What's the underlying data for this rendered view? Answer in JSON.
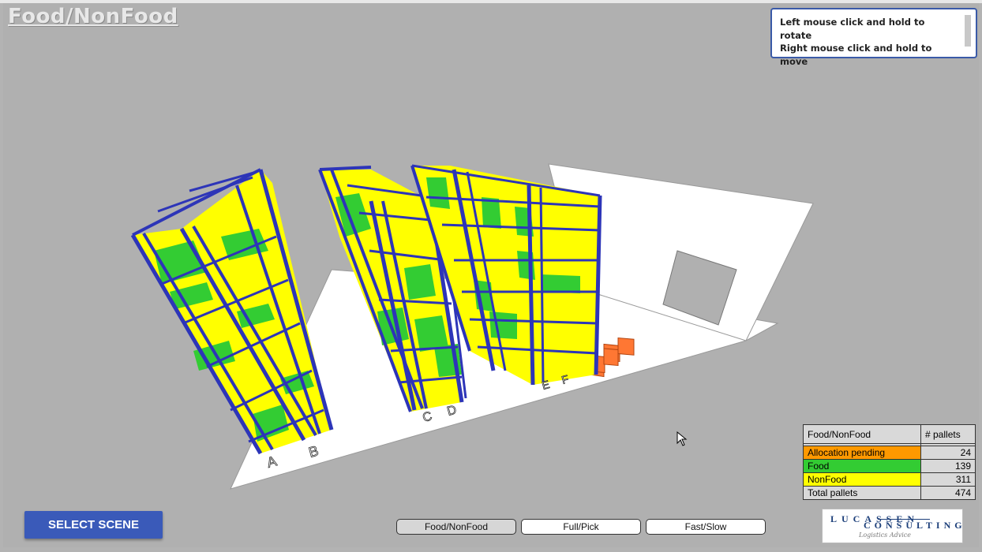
{
  "title": "Food/NonFood",
  "help": {
    "line1": "Left mouse click and hold to rotate",
    "line2": "Right mouse click and hold to",
    "line3": "move"
  },
  "aisle_labels": [
    "A",
    "B",
    "C",
    "D",
    "E",
    "F"
  ],
  "legend": {
    "header": "Food/NonFood",
    "count_header": "# pallets",
    "rows": [
      {
        "label": "Allocation pending",
        "value": "24",
        "color": "#ff9900"
      },
      {
        "label": "Food",
        "value": "139",
        "color": "#33cc33"
      },
      {
        "label": "NonFood",
        "value": "311",
        "color": "#ffff00"
      }
    ],
    "total_label": "Total pallets",
    "total_value": "474"
  },
  "buttons": {
    "select_scene": "SELECT SCENE",
    "food_nonfood": "Food/NonFood",
    "full_pick": "Full/Pick",
    "fast_slow": "Fast/Slow"
  },
  "logo": {
    "line1": "LUCASSEN",
    "line2": "CONSULTING",
    "tagline": "Logistics Advice"
  },
  "colors": {
    "rack": "#2d35b8",
    "food": "#33cc33",
    "nonfood": "#ffff00",
    "pending": "#ff7733",
    "background": "#b0b0b0"
  }
}
